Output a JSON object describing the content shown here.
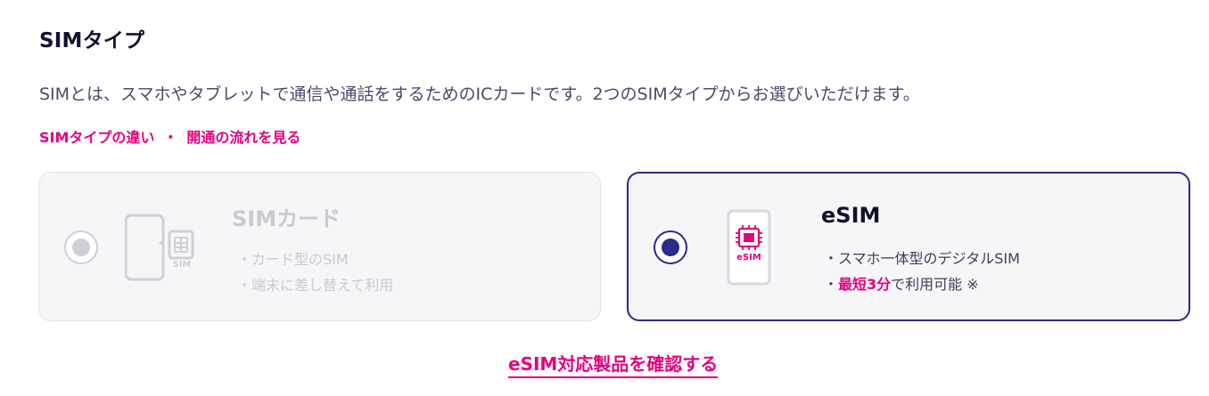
{
  "section": {
    "title": "SIMタイプ",
    "description": "SIMとは、スマホやタブレットで通信や通話をするためのICカードです。2つのSIMタイプからお選びいただけます。",
    "link_difference": "SIMタイプの違い",
    "link_separator": "・",
    "link_flow": "開通の流れを見る"
  },
  "options": {
    "sim_card": {
      "title": "SIMカード",
      "icon": "phone-with-sim-card-icon",
      "icon_label": "SIM",
      "state": "disabled",
      "feature_1": "・カード型のSIM",
      "feature_2": "・端末に差し替えて利用"
    },
    "esim": {
      "title": "eSIM",
      "icon": "phone-with-esim-chip-icon",
      "icon_label": "eSIM",
      "state": "selected",
      "feature_1": "・スマホ一体型のデジタルSIM",
      "feature_2_prefix": "・",
      "feature_2_highlight": "最短3分",
      "feature_2_suffix": "で利用可能 ※"
    }
  },
  "cta": {
    "label": "eSIM対応製品を確認する"
  },
  "colors": {
    "accent": "#e4007f",
    "primary": "#2c2a8a",
    "disabled": "#c9c9d6",
    "card_bg": "#f6f6f8"
  }
}
